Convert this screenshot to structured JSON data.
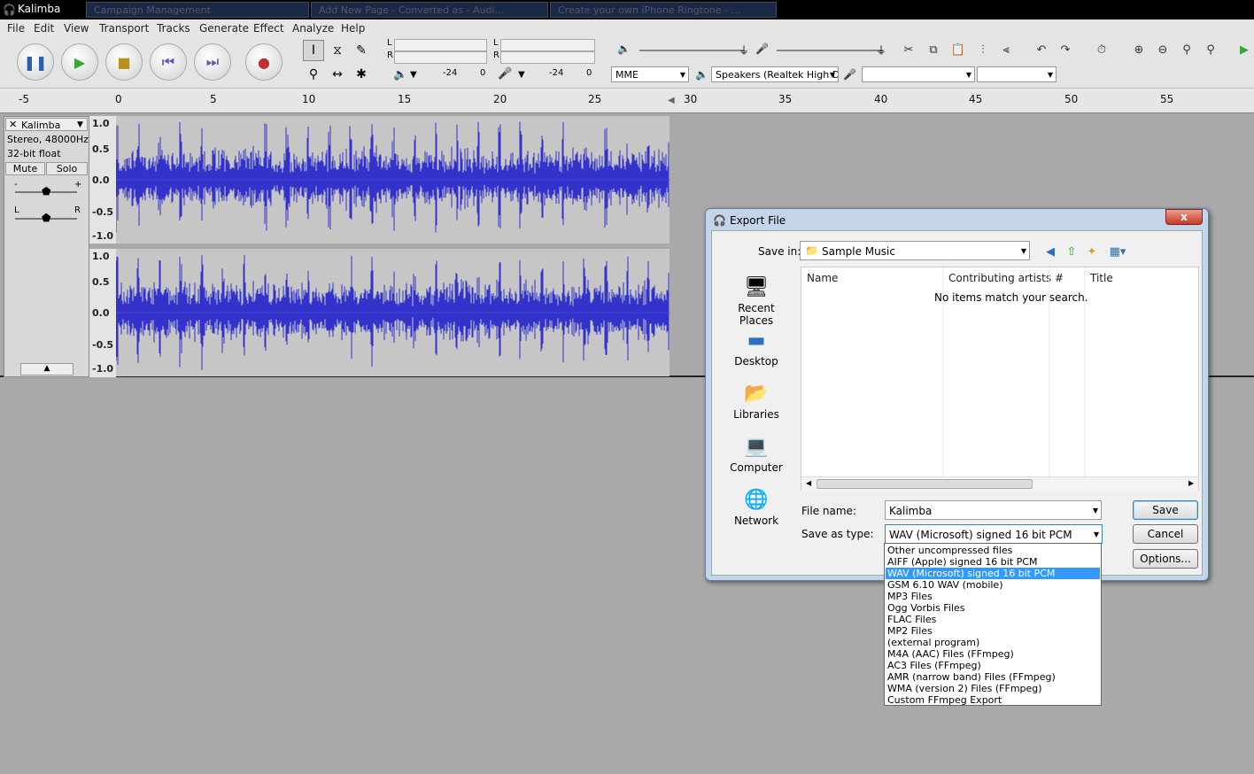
{
  "window": {
    "title": "Kalimba",
    "ghost_tabs": [
      "Campaign Management",
      "Add New Page - Converted as - Audi...",
      "Create your own iPhone Ringtone - ..."
    ]
  },
  "menu": [
    "File",
    "Edit",
    "View",
    "Transport",
    "Tracks",
    "Generate",
    "Effect",
    "Analyze",
    "Help"
  ],
  "meters": {
    "left_label": "L",
    "right_label": "R",
    "play_scale": [
      "-24",
      "0"
    ],
    "rec_scale": [
      "-24",
      "0"
    ]
  },
  "device": {
    "host": "MME",
    "output": "Speakers (Realtek High D",
    "input": "",
    "channels": ""
  },
  "ruler": {
    "ticks": [
      "-5",
      "0",
      "5",
      "10",
      "15",
      "20",
      "25",
      "30",
      "35",
      "40",
      "45",
      "50",
      "55"
    ]
  },
  "track": {
    "name": "Kalimba",
    "info1": "Stereo, 48000Hz",
    "info2": "32-bit float",
    "mute": "Mute",
    "solo": "Solo",
    "gain_minus": "-",
    "gain_plus": "+",
    "pan_left": "L",
    "pan_right": "R",
    "scale": [
      "1.0",
      "0.5",
      "0.0",
      "-0.5",
      "-1.0"
    ]
  },
  "dialog": {
    "title": "Export File",
    "save_in_label": "Save in:",
    "save_in_value": "Sample Music",
    "places": [
      "Recent Places",
      "Desktop",
      "Libraries",
      "Computer",
      "Network"
    ],
    "columns": [
      "Name",
      "Contributing artists",
      "#",
      "Title"
    ],
    "empty_message": "No items match your search.",
    "file_name_label": "File name:",
    "file_name_value": "Kalimba",
    "save_as_type_label": "Save as type:",
    "save_as_type_value": "WAV (Microsoft) signed 16 bit PCM",
    "buttons": {
      "save": "Save",
      "cancel": "Cancel",
      "options": "Options..."
    },
    "close": "x"
  },
  "file_types": [
    "Other uncompressed files",
    "AIFF (Apple) signed 16 bit PCM",
    "WAV (Microsoft) signed 16 bit PCM",
    "GSM 6.10 WAV (mobile)",
    "MP3 Files",
    "Ogg Vorbis Files",
    "FLAC Files",
    "MP2 Files",
    "(external program)",
    "M4A (AAC) Files (FFmpeg)",
    "AC3 Files (FFmpeg)",
    "AMR (narrow band) Files (FFmpeg)",
    "WMA (version 2) Files (FFmpeg)",
    "Custom FFmpeg Export"
  ],
  "selected_file_type_index": 2,
  "colors": {
    "waveform": "#3333cc",
    "highlight": "#3399ff",
    "titlebar": "#000000"
  }
}
